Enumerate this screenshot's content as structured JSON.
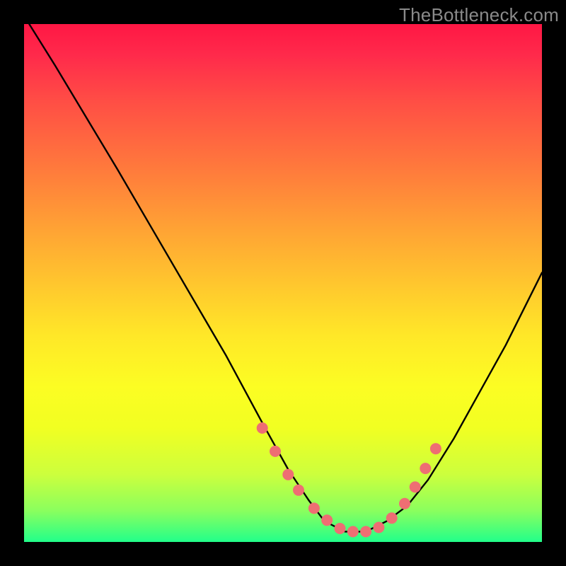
{
  "watermark": "TheBottleneck.com",
  "chart_data": {
    "type": "line",
    "title": "",
    "xlabel": "",
    "ylabel": "",
    "xlim": [
      0,
      100
    ],
    "ylim": [
      0,
      100
    ],
    "series": [
      {
        "name": "curve",
        "x": [
          1,
          6,
          12,
          18,
          25,
          32,
          39,
          46,
          51,
          55,
          58,
          62,
          66,
          70,
          74,
          78,
          83,
          88,
          93,
          100
        ],
        "y": [
          100,
          92,
          82,
          72,
          60,
          48,
          36,
          23,
          14,
          8,
          4,
          2,
          2,
          4,
          7,
          12,
          20,
          29,
          38,
          52
        ]
      }
    ],
    "markers": {
      "name": "dots",
      "color": "#ee6e73",
      "radius_px": 8,
      "x": [
        46,
        48.5,
        51,
        53,
        56,
        58.5,
        61,
        63.5,
        66,
        68.5,
        71,
        73.5,
        75.5,
        77.5,
        79.5
      ],
      "y": [
        22,
        17.5,
        13,
        10,
        6.5,
        4.2,
        2.6,
        2.0,
        2.0,
        2.8,
        4.6,
        7.4,
        10.6,
        14.2,
        18.0
      ]
    }
  }
}
